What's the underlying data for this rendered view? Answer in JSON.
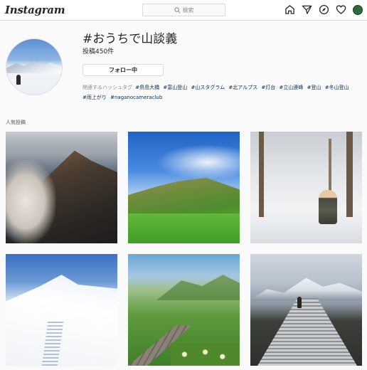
{
  "topbar": {
    "logo_text": "Instagram",
    "search_placeholder": "検索",
    "icons": [
      "home-icon",
      "direct-message-icon",
      "explore-compass-icon",
      "activity-heart-icon",
      "profile-avatar"
    ]
  },
  "header": {
    "hashtag": "#おうちで山談義",
    "post_count": "投稿450件",
    "follow_button_label": "フォロー中",
    "related_label": "関連するハッシュタグ",
    "related_hashtags": [
      "#鳥島大橋",
      "#富山登山",
      "#山スタグラム",
      "#北アルプス",
      "#灯台",
      "#立山連峰",
      "#登山",
      "#冬山登山",
      "#雨上がり",
      "#naganocameraclub"
    ]
  },
  "popular": {
    "label": "人気投稿"
  },
  "colors": {
    "link": "#003569",
    "border": "#dbdbdb",
    "background": "#fafafa",
    "text": "#262626",
    "muted": "#8e8e8e"
  }
}
